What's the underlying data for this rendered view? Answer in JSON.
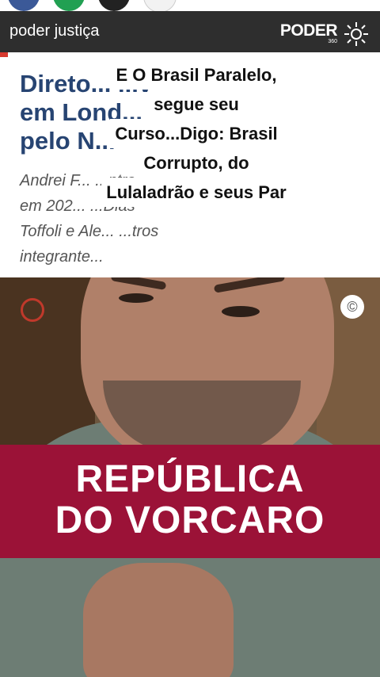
{
  "header": {
    "channel_name": "poder justiça",
    "logo_word": "PODER",
    "logo_number": "360"
  },
  "article": {
    "headline_lines": [
      "Direto... ...vento",
      "em Lond... ...ado",
      "pelo N..."
    ],
    "lede_lines": [
      "Andrei F... ...ntro",
      "em 202... ...Dias",
      "Toffoli e Ale... ...tros",
      "integrante..."
    ],
    "accent_color": "#d83a2f"
  },
  "caption": {
    "lines": [
      "E O Brasil Paralelo,",
      "segue seu",
      "Curso...Digo: Brasil",
      "Corrupto, do",
      "Lulaladrão e seus Par"
    ]
  },
  "video": {
    "copyright_symbol": "©",
    "banner_lines": [
      "REPÚBLICA",
      "DO VORCARO"
    ],
    "banner_color": "#9b1237"
  },
  "icons": {
    "poder_logo": "sunburst-logo-icon",
    "copyright": "copyright-icon"
  }
}
